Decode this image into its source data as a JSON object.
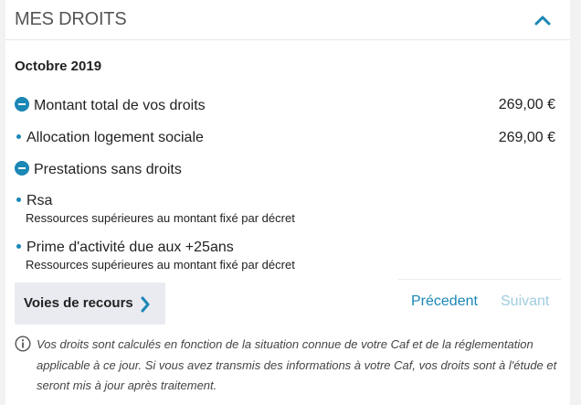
{
  "header": {
    "title": "MES DROITS",
    "collapse_icon": "chevron-up-icon"
  },
  "period": "Octobre 2019",
  "rights": {
    "total": {
      "label": "Montant total de vos droits",
      "amount": "269,00 €"
    },
    "items": [
      {
        "label": "Allocation logement sociale",
        "amount": "269,00 €"
      }
    ]
  },
  "no_rights": {
    "label": "Prestations sans droits",
    "items": [
      {
        "label": "Rsa",
        "reason": "Ressources supérieures au montant fixé par décret"
      },
      {
        "label": "Prime d'activité due aux +25ans",
        "reason": "Ressources supérieures au montant fixé par décret"
      }
    ]
  },
  "actions": {
    "appeal_label": "Voies de recours",
    "previous_label": "Précedent",
    "next_label": "Suivant"
  },
  "info": {
    "text": "Vos droits sont calculés en fonction de la situation connue de votre Caf et de la réglementation applicable à ce jour. Si vous avez transmis des informations à votre Caf, vos droits sont à l'étude et seront mis à jour après traitement."
  },
  "colors": {
    "accent": "#1b87b5",
    "accent_disabled": "#9fcde0",
    "button_bg": "#e9ebf1"
  }
}
